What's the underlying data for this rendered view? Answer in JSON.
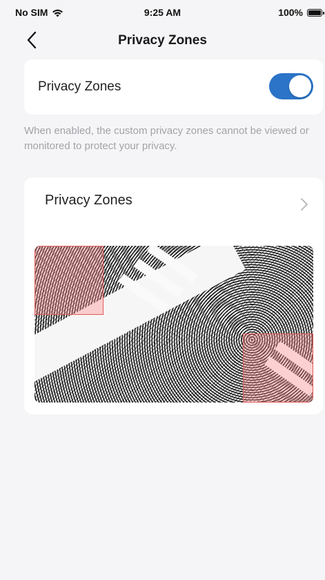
{
  "status_bar": {
    "carrier": "No SIM",
    "time": "9:25 AM",
    "battery": "100%",
    "battery_level": 1.0
  },
  "nav": {
    "title": "Privacy Zones",
    "back_icon": "chevron-left-icon"
  },
  "toggle": {
    "label": "Privacy Zones",
    "enabled": true,
    "accent": "#2b74c7"
  },
  "description": "When enabled, the custom privacy zones cannot be viewed or monitored to protect your privacy.",
  "zones_section": {
    "label": "Privacy Zones",
    "chevron_icon": "chevron-right-icon",
    "zone_color": "#e05a5a"
  }
}
